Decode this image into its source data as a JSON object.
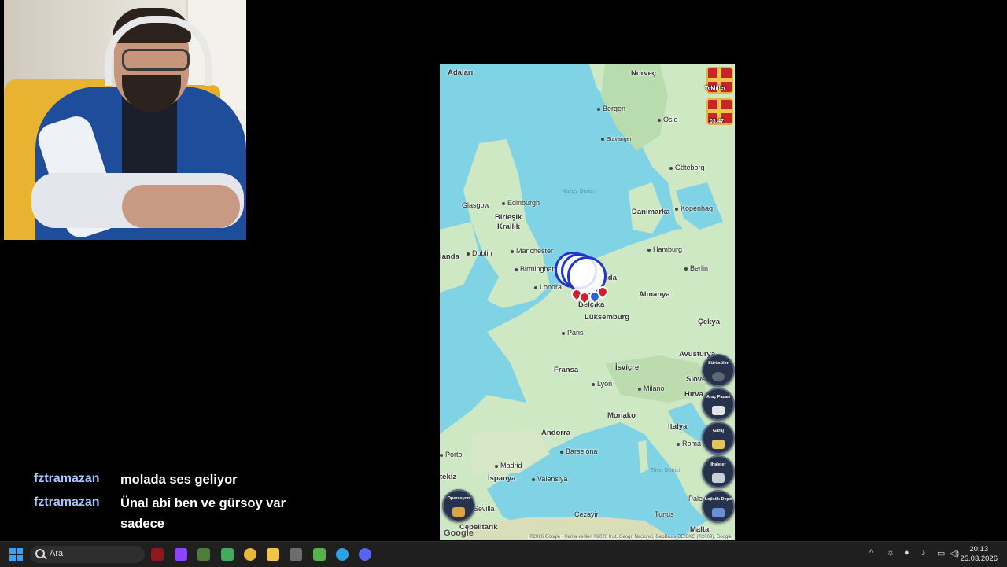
{
  "chat": {
    "messages": [
      {
        "user": "fztramazan",
        "text": "molada ses geliyor"
      },
      {
        "user": "fztramazan",
        "text": "Ünal abi ben ve gürsoy var sadece"
      }
    ]
  },
  "map": {
    "labels": {
      "adalari": "Adaları",
      "norvec": "Norveç",
      "bergen": "Bergen",
      "oslo": "Oslo",
      "stavanger": "Stavanger",
      "goteborg": "Göteborg",
      "kuzey_denizi": "Kuzey Denizi",
      "edinburgh": "Edinburgh",
      "glasgow": "Glasgow",
      "birlesik": "Birleşik",
      "krallik": "Krallık",
      "danimarka": "Danimarka",
      "kopenhag": "Kopenhag",
      "irlanda": "landa",
      "dublin": "Dublin",
      "manchester": "Manchester",
      "hamburg": "Hamburg",
      "birmingham": "Birmingham",
      "berlin": "Berlin",
      "hollanda": "nda",
      "londra": "Londra",
      "belcika": "Belçika",
      "almanya": "Almanya",
      "luksemburg": "Lüksemburg",
      "cekya": "Çekya",
      "paris": "Paris",
      "avusturya": "Avusturya",
      "fransa": "Fransa",
      "isvicre": "İsviçre",
      "slovenya": "Slove",
      "lyon": "Lyon",
      "milano": "Milano",
      "hirvatistan": "Hırva",
      "monako": "Monako",
      "italya": "İtalya",
      "andorra": "Andorra",
      "barselona": "Barselona",
      "roma": "Roma",
      "porto": "Porto",
      "madrid": "Madrid",
      "tiren_denizi": "Tiren Denizi",
      "portekiz": "tekiz",
      "ispanya": "İspanya",
      "valensiya": "Valensiya",
      "palermo": "Pale",
      "sevilla": "Sevilla",
      "cezayir": "Cezayir",
      "tunus": "Tunus",
      "cebelitarik": "Cebelitarık",
      "malta": "Malta"
    },
    "gifts": [
      {
        "label": "Teklifler",
        "icon": "gift-icon"
      },
      {
        "label": "03:47",
        "icon": "gift-timer-icon"
      }
    ],
    "side_buttons": [
      {
        "label": "Sürücüler",
        "icon": "driver-icon"
      },
      {
        "label": "Araç Pazarı",
        "icon": "camera-icon"
      },
      {
        "label": "Garaj",
        "icon": "wrench-icon"
      },
      {
        "label": "İhaleler",
        "icon": "auction-icon"
      },
      {
        "label": "Lojistik Depo",
        "icon": "warehouse-icon"
      }
    ],
    "operation_button": {
      "label": "Operasyon",
      "icon": "operation-icon"
    },
    "google": "Google",
    "attribution": "©2026 Google · Harita verileri ©2026 Inst. Geogr. Nacional, GeoBasis-DE/BKG (©2009), Google"
  },
  "taskbar": {
    "search_placeholder": "Ara",
    "time": "20:13",
    "date": "25.03.2026"
  },
  "colors": {
    "sea": "#7fd3e4",
    "land": "#cfe8c4",
    "chat_user": "#a9c7ff",
    "taskbar": "#1f1f1f"
  }
}
